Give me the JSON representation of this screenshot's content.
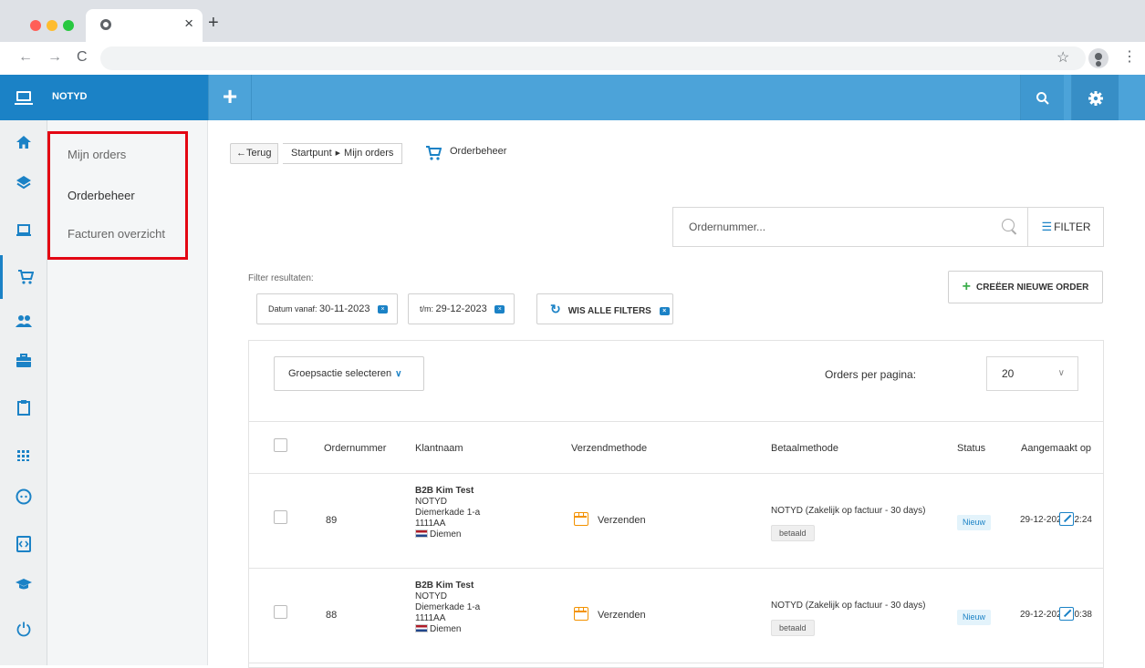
{
  "browser": {
    "tab_close": "×",
    "new_tab": "+",
    "back": "←",
    "forward": "→",
    "reload": "C",
    "star": "☆",
    "menu": "⋮"
  },
  "header": {
    "brand": "NOTYD",
    "add": "+",
    "icons": {
      "search": "search-icon",
      "settings": "gear-icon"
    },
    "colors": {
      "brand_bg": "#1b82c6",
      "bar_bg": "#4ca3d9"
    }
  },
  "rail": {
    "items": [
      "home-icon",
      "layers-icon",
      "laptop-icon",
      "cart-icon",
      "users-icon",
      "briefcase-icon",
      "clipboard-icon",
      "grid-icon",
      "face-icon",
      "code-icon",
      "graduation-cap-icon",
      "power-icon"
    ],
    "active": "cart-icon"
  },
  "submenu": {
    "items": [
      {
        "label": "Mijn orders"
      },
      {
        "label": "Orderbeheer",
        "active": true
      },
      {
        "label": "Facturen overzicht"
      }
    ],
    "highlight_color": "#e30613"
  },
  "breadcrumb": {
    "back": "←Terug",
    "path1": "Startpunt",
    "path2": "Mijn orders",
    "title": "Orderbeheer"
  },
  "search": {
    "placeholder": "Ordernummer...",
    "value": "",
    "filter": "FILTER"
  },
  "filters": {
    "label": "Filter resultaten:",
    "from_label": "Datum vanaf:",
    "from_value": "30-11-2023",
    "to_label": "t/m:",
    "to_value": "29-12-2023",
    "clear_all": "WIS ALLE FILTERS",
    "remove": "×"
  },
  "actions": {
    "new_order": "CREËER NIEUWE ORDER"
  },
  "table_controls": {
    "group_action": "Groepsactie selecteren",
    "per_page_label": "Orders per pagina:",
    "per_page": "20"
  },
  "table": {
    "headers": [
      "Ordernummer",
      "Klantnaam",
      "Verzendmethode",
      "Betaalmethode",
      "Status",
      "Aangemaakt op"
    ],
    "rows": [
      {
        "order": "89",
        "customer": {
          "name": "B2B Kim Test",
          "company": "NOTYD",
          "street": "Diemerkade 1-a",
          "zip": "1111AA",
          "city": "Diemen"
        },
        "shipping": "Verzenden",
        "payment": "NOTYD (Zakelijk op factuur - 30 days)",
        "paid": "betaald",
        "status": "Nieuw",
        "date": "29-12-2023",
        "time": "12:24"
      },
      {
        "order": "88",
        "customer": {
          "name": "B2B Kim Test",
          "company": "NOTYD",
          "street": "Diemerkade 1-a",
          "zip": "1111AA",
          "city": "Diemen"
        },
        "shipping": "Verzenden",
        "payment": "NOTYD (Zakelijk op factuur - 30 days)",
        "paid": "betaald",
        "status": "Nieuw",
        "date": "29-12-2023",
        "time": "10:38"
      }
    ]
  }
}
